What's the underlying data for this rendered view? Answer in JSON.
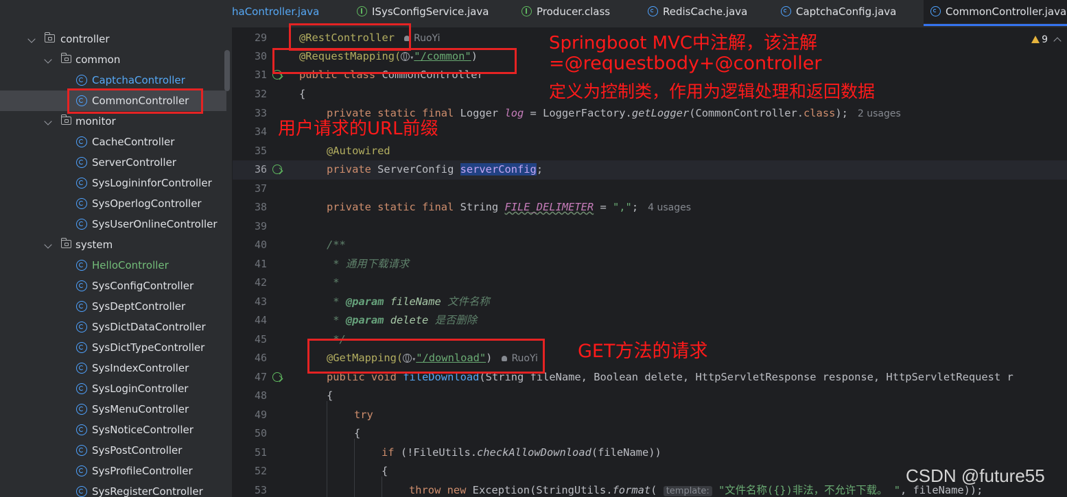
{
  "tabs": [
    {
      "label": "haController.java",
      "icon": "class-icon"
    },
    {
      "label": "ISysConfigService.java",
      "icon": "interface-icon"
    },
    {
      "label": "Producer.class",
      "icon": "interface-icon"
    },
    {
      "label": "RedisCache.java",
      "icon": "class-icon"
    },
    {
      "label": "CaptchaConfig.java",
      "icon": "class-icon"
    },
    {
      "label": "CommonController.java",
      "icon": "class-icon",
      "active": true
    }
  ],
  "tree": [
    {
      "label": "controller",
      "type": "folder"
    },
    {
      "label": "common",
      "type": "folder"
    },
    {
      "label": "CaptchaController",
      "type": "class"
    },
    {
      "label": "CommonController",
      "type": "class",
      "selected": true
    },
    {
      "label": "monitor",
      "type": "folder"
    },
    {
      "label": "CacheController",
      "type": "class"
    },
    {
      "label": "ServerController",
      "type": "class"
    },
    {
      "label": "SysLogininforController",
      "type": "class"
    },
    {
      "label": "SysOperlogController",
      "type": "class"
    },
    {
      "label": "SysUserOnlineController",
      "type": "class"
    },
    {
      "label": "system",
      "type": "folder"
    },
    {
      "label": "HelloController",
      "type": "class"
    },
    {
      "label": "SysConfigController",
      "type": "class"
    },
    {
      "label": "SysDeptController",
      "type": "class"
    },
    {
      "label": "SysDictDataController",
      "type": "class"
    },
    {
      "label": "SysDictTypeController",
      "type": "class"
    },
    {
      "label": "SysIndexController",
      "type": "class"
    },
    {
      "label": "SysLoginController",
      "type": "class"
    },
    {
      "label": "SysMenuController",
      "type": "class"
    },
    {
      "label": "SysNoticeController",
      "type": "class"
    },
    {
      "label": "SysPostController",
      "type": "class"
    },
    {
      "label": "SysProfileController",
      "type": "class"
    },
    {
      "label": "SysRegisterController",
      "type": "class"
    }
  ],
  "editor": {
    "warning_count": "9",
    "line_numbers": [
      "29",
      "30",
      "31",
      "32",
      "33",
      "34",
      "35",
      "36",
      "37",
      "38",
      "39",
      "40",
      "41",
      "42",
      "43",
      "44",
      "45",
      "46",
      "47",
      "48",
      "49",
      "50",
      "51",
      "52",
      "53"
    ],
    "author": "RuoYi",
    "l29_ann": "@RestController",
    "l30_ann": "@RequestMapping(",
    "l30_str": "\"/common\"",
    "l30_end": ")",
    "l31_kw": "public class ",
    "l31_name": "CommonController",
    "l32": "{",
    "l33_kw": "private static final ",
    "l33_type": "Logger ",
    "l33_var": "log",
    "l33_eq": " = LoggerFactory.",
    "l33_fn": "getLogger",
    "l33_rest": "(CommonController.",
    "l33_cls": "class",
    "l33_end": ");",
    "l33_hint": "2 usages",
    "l35_ann": "@Autowired",
    "l36_kw": "private ",
    "l36_type": "ServerConfig ",
    "l36_var": "serverConfig",
    "l36_end": ";",
    "l38_kw": "private static final ",
    "l38_type": "String ",
    "l38_var": "FILE_DELIMETER",
    "l38_eq": " = ",
    "l38_str": "\",\"",
    "l38_end": ";",
    "l38_hint": "4 usages",
    "l40": "/**",
    "l41": " * 通用下载请求",
    "l42": " *",
    "l43_star": " * ",
    "l43_tag": "@param ",
    "l43_p": "fileName",
    "l43_d": " 文件名称",
    "l44_star": " * ",
    "l44_tag": "@param ",
    "l44_p": "delete",
    "l44_d": " 是否删除",
    "l45": " */",
    "l46_ann": "@GetMapping(",
    "l46_str": "\"/download\"",
    "l46_end": ")",
    "l47_kw": "public void ",
    "l47_fn": "fileDownload",
    "l47_rest": "(String fileName, Boolean delete, HttpServletResponse response, HttpServletRequest r",
    "l48": "{",
    "l49": "try",
    "l50": "{",
    "l51_kw": "if ",
    "l51_a": "(!FileUtils.",
    "l51_fn": "checkAllowDownload",
    "l51_b": "(fileName))",
    "l52": "{",
    "l53_kw": "throw new ",
    "l53_a": "Exception(StringUtils.",
    "l53_fn": "format",
    "l53_b": "( ",
    "l53_inlay": "template:",
    "l53_str": " \"文件名称({})非法，不允许下载。 \"",
    "l53_end": ", fileName));"
  },
  "annotations": {
    "springboot_line1": "Springboot MVC中注解，该注解",
    "springboot_line2": "=@requestbody+@controller",
    "springboot_line3": "定义为控制类，作用为逻辑处理和返回数据",
    "url_prefix": "用户请求的URL前缀",
    "get_method": "GET方法的请求"
  },
  "watermark": "CSDN @future55",
  "colors": {
    "annotation_red": "#ff1a1a",
    "accent": "#3574f0"
  }
}
